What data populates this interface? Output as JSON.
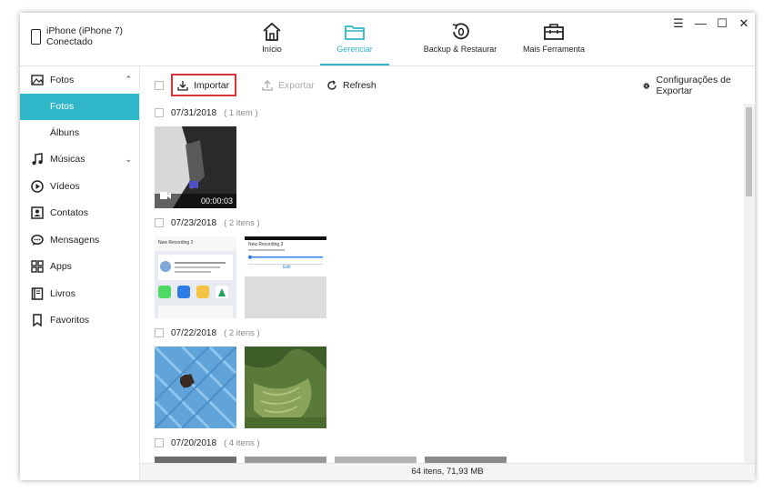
{
  "device": {
    "name": "iPhone (iPhone 7)",
    "status": "Conectado"
  },
  "nav": [
    {
      "label": "Início",
      "icon": "home-icon",
      "active": false
    },
    {
      "label": "Gerenciar",
      "icon": "folder-icon",
      "active": true
    },
    {
      "label": "Backup & Restaurar",
      "icon": "backup-restore-icon",
      "active": false
    },
    {
      "label": "Mais Ferramenta",
      "icon": "toolbox-icon",
      "active": false
    }
  ],
  "window_controls": {
    "menu": "☰",
    "minimize": "—",
    "maximize": "☐",
    "close": "✕"
  },
  "sidebar": {
    "photos": {
      "label": "Fotos",
      "sub": [
        {
          "label": "Fotos",
          "active": true
        },
        {
          "label": "Álbuns",
          "active": false
        }
      ]
    },
    "items": [
      {
        "label": "Músicas",
        "icon": "music-icon"
      },
      {
        "label": "Vídeos",
        "icon": "play-circle-icon"
      },
      {
        "label": "Contatos",
        "icon": "contact-icon"
      },
      {
        "label": "Mensagens",
        "icon": "message-icon"
      },
      {
        "label": "Apps",
        "icon": "apps-icon"
      },
      {
        "label": "Livros",
        "icon": "book-icon"
      },
      {
        "label": "Favoritos",
        "icon": "bookmark-icon"
      }
    ]
  },
  "toolbar": {
    "import_label": "Importar",
    "export_label": "Exportar",
    "refresh_label": "Refresh",
    "settings_label": "Configurações de Exportar"
  },
  "groups": [
    {
      "date": "07/31/2018",
      "count": "( 1 item )",
      "video_duration": "00:00:03"
    },
    {
      "date": "07/23/2018",
      "count": "( 2 itens )",
      "thumb1_title": "New Recording 2",
      "thumb2_title": "New Recording 2",
      "thumb2_action": "Edit"
    },
    {
      "date": "07/22/2018",
      "count": "( 2 itens )"
    },
    {
      "date": "07/20/2018",
      "count": "( 4 itens )"
    }
  ],
  "status": {
    "summary": "64 itens, 71,93 MB"
  },
  "colors": {
    "accent": "#2fb6c8",
    "highlight": "#d9343a"
  }
}
